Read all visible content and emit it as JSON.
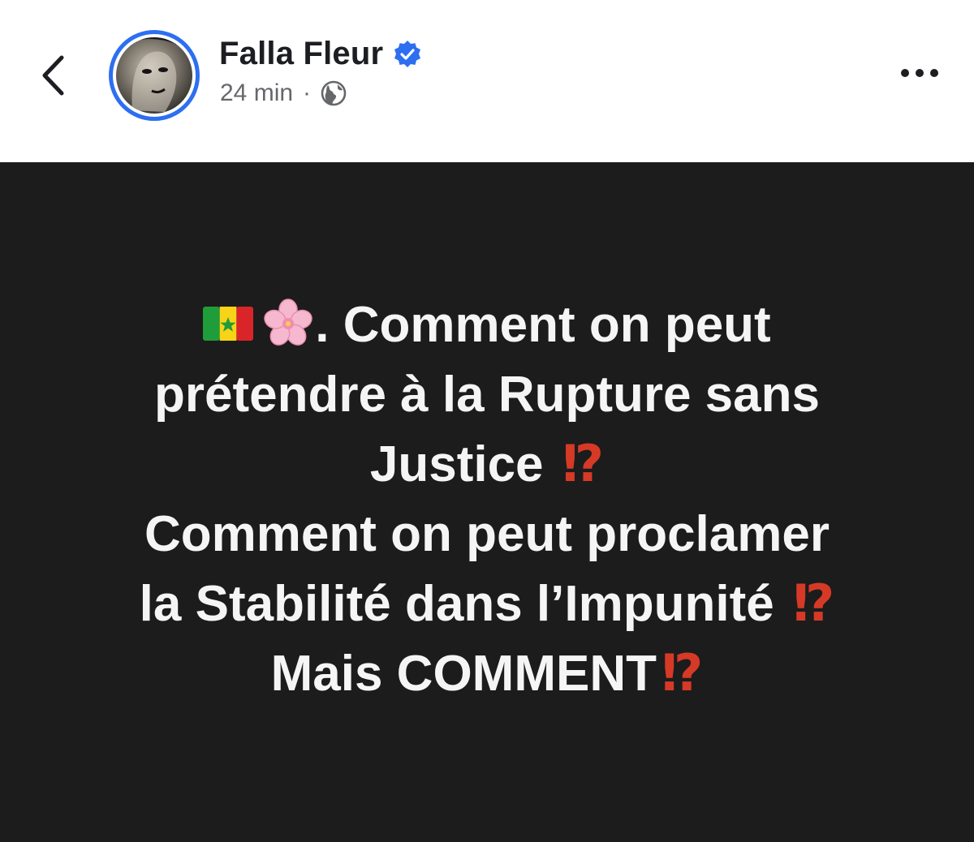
{
  "header": {
    "author_name": "Falla Fleur",
    "timestamp": "24 min",
    "separator": "·",
    "back_icon": "chevron-left-icon",
    "verified_icon": "verified-badge-icon",
    "privacy_icon": "globe-icon",
    "more_icon": "more-dots-icon",
    "accent_color": "#2d6ff0"
  },
  "post": {
    "background_color": "#1c1c1c",
    "text_color": "#f5f5f5",
    "interrobang_color": "#d63a26",
    "lines": [
      ". Comment on peut",
      "prétendre à la Rupture sans",
      "Justice",
      "Comment on peut proclamer",
      "la Stabilité dans l’Impunité",
      "Mais COMMENT"
    ],
    "interrobang": "⁉"
  }
}
